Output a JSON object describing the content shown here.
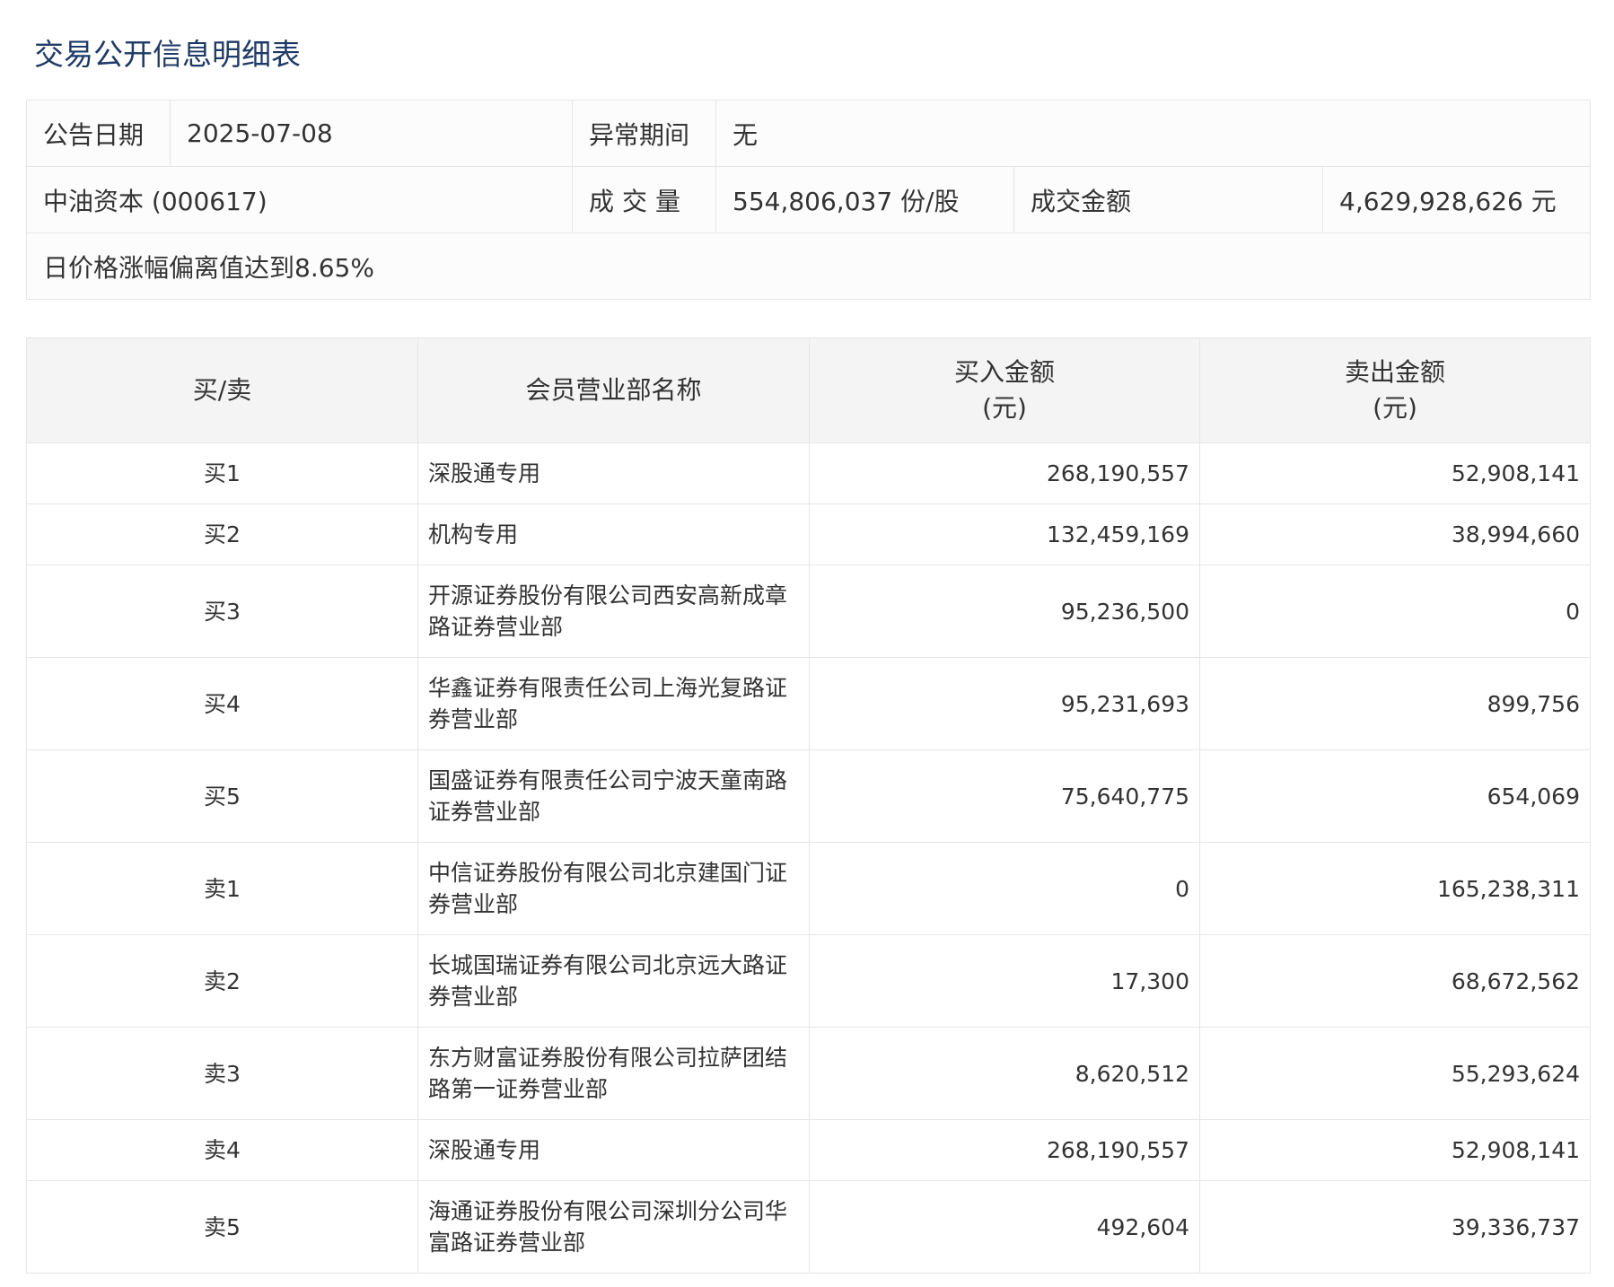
{
  "page": {
    "title": "交易公开信息明细表"
  },
  "info": {
    "announce_date_label": "公告日期",
    "announce_date_value": "2025-07-08",
    "abnormal_period_label": "异常期间",
    "abnormal_period_value": "无",
    "stock_name": "中油资本 (000617)",
    "volume_label": "成交量",
    "volume_value": "554,806,037 份/股",
    "amount_label": "成交金额",
    "amount_value": "4,629,928,626 元",
    "reason": "日价格涨幅偏离值达到8.65%"
  },
  "table": {
    "headers": {
      "side": "买/卖",
      "member": "会员营业部名称",
      "buy_line1": "买入金额",
      "buy_line2": "(元)",
      "sell_line1": "卖出金额",
      "sell_line2": "(元)"
    },
    "rows": [
      {
        "side": "买1",
        "name": "深股通专用",
        "buy": "268,190,557",
        "sell": "52,908,141"
      },
      {
        "side": "买2",
        "name": "机构专用",
        "buy": "132,459,169",
        "sell": "38,994,660"
      },
      {
        "side": "买3",
        "name": "开源证券股份有限公司西安高新成章路证券营业部",
        "buy": "95,236,500",
        "sell": "0"
      },
      {
        "side": "买4",
        "name": "华鑫证券有限责任公司上海光复路证券营业部",
        "buy": "95,231,693",
        "sell": "899,756"
      },
      {
        "side": "买5",
        "name": "国盛证券有限责任公司宁波天童南路证券营业部",
        "buy": "75,640,775",
        "sell": "654,069"
      },
      {
        "side": "卖1",
        "name": "中信证券股份有限公司北京建国门证券营业部",
        "buy": "0",
        "sell": "165,238,311"
      },
      {
        "side": "卖2",
        "name": "长城国瑞证券有限公司北京远大路证券营业部",
        "buy": "17,300",
        "sell": "68,672,562"
      },
      {
        "side": "卖3",
        "name": "东方财富证券股份有限公司拉萨团结路第一证券营业部",
        "buy": "8,620,512",
        "sell": "55,293,624"
      },
      {
        "side": "卖4",
        "name": "深股通专用",
        "buy": "268,190,557",
        "sell": "52,908,141"
      },
      {
        "side": "卖5",
        "name": "海通证券股份有限公司深圳分公司华富路证券营业部",
        "buy": "492,604",
        "sell": "39,336,737"
      }
    ]
  }
}
